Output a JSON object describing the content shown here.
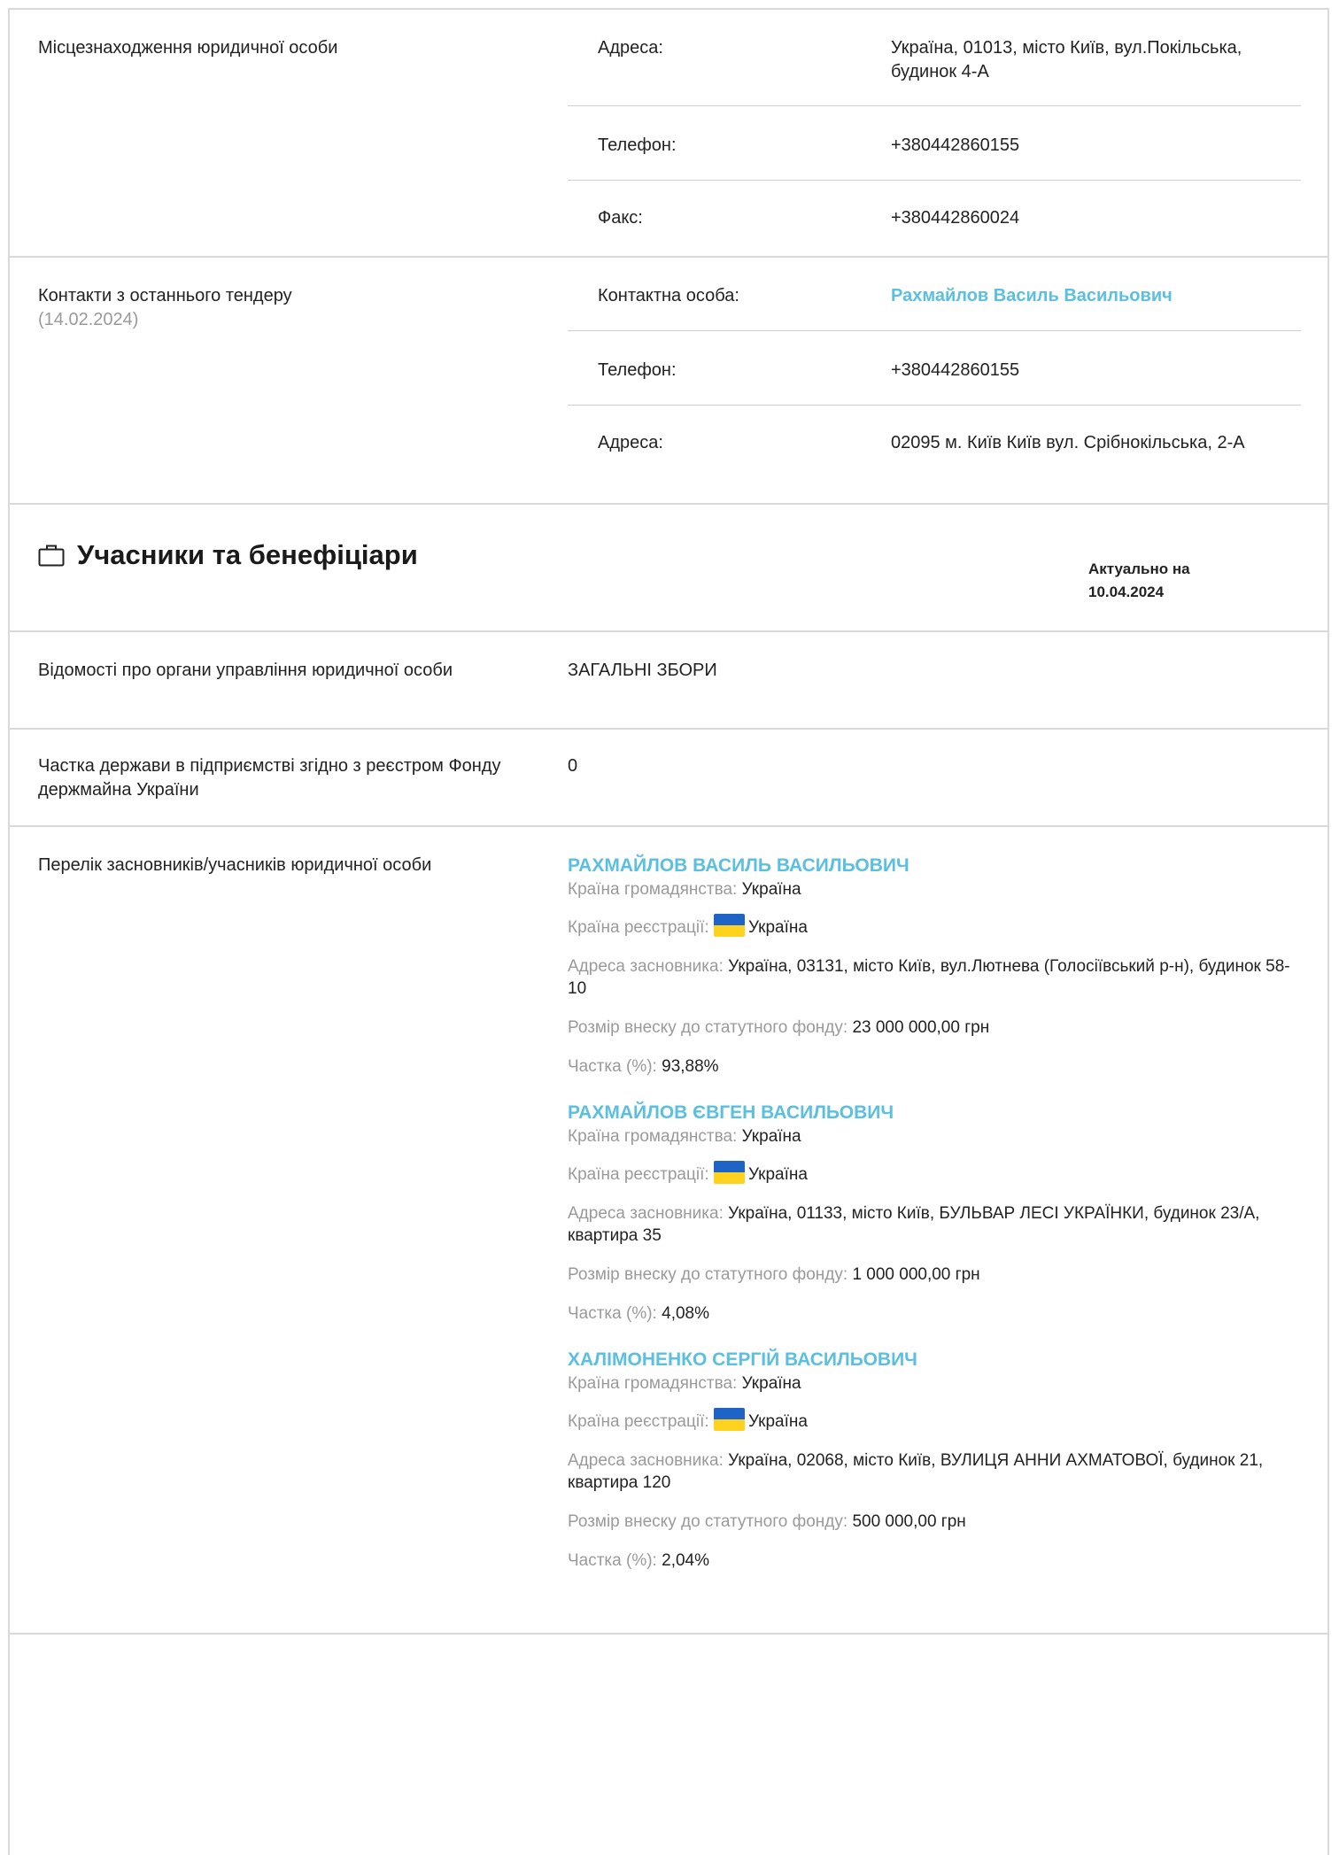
{
  "location": {
    "label": "Місцезнаходження юридичної особи",
    "address_key": "Адреса:",
    "address_val": "Україна, 01013, місто Київ, вул.Покільська, будинок 4-А",
    "phone_key": "Телефон:",
    "phone_val": "+380442860155",
    "fax_key": "Факс:",
    "fax_val": "+380442860024"
  },
  "tender": {
    "label": "Контакти з останнього тендеру",
    "date": "(14.02.2024)",
    "person_key": "Контактна особа:",
    "person_val": "Рахмайлов Василь Васильович",
    "phone_key": "Телефон:",
    "phone_val": "+380442860155",
    "address_key": "Адреса:",
    "address_val": "02095 м. Київ Київ вул. Срібнокільська, 2-А"
  },
  "participants": {
    "title": "Учасники та бенефіціари",
    "asof_label": "Актуально на",
    "asof_date": "10.04.2024",
    "icon": "briefcase-icon"
  },
  "governance": {
    "label": "Відомості про органи управління юридичної особи",
    "value": "ЗАГАЛЬНІ ЗБОРИ"
  },
  "state_share": {
    "label": "Частка держави в підприємстві згідно з реєстром Фонду держмайна України",
    "value": "0"
  },
  "founders": {
    "label": "Перелік засновників/учасників юридичної особи",
    "k_citizenship": "Країна громадянства:",
    "k_registration": "Країна реєстрації:",
    "k_address": "Адреса засновника:",
    "k_contribution": "Розмір внеску до статутного фонду:",
    "k_share": "Частка (%):",
    "items": [
      {
        "name": "РАХМАЙЛОВ ВАСИЛЬ ВАСИЛЬОВИЧ",
        "citizenship": "Україна",
        "registration": "Україна",
        "address": "Україна, 03131, місто Київ, вул.Лютнева (Голосіївський р-н), будинок 58-10",
        "contribution": "23 000 000,00 грн",
        "share": "93,88%"
      },
      {
        "name": "РАХМАЙЛОВ ЄВГЕН ВАСИЛЬОВИЧ",
        "citizenship": "Україна",
        "registration": "Україна",
        "address": "Україна, 01133, місто Київ, БУЛЬВАР ЛЕСІ УКРАЇНКИ, будинок 23/А, квартира 35",
        "contribution": "1 000 000,00 грн",
        "share": "4,08%"
      },
      {
        "name": "ХАЛІМОНЕНКО СЕРГІЙ ВАСИЛЬОВИЧ",
        "citizenship": "Україна",
        "registration": "Україна",
        "address": "Україна, 02068, місто Київ, ВУЛИЦЯ АННИ АХМАТОВОЇ, будинок 21, квартира 120",
        "contribution": "500 000,00 грн",
        "share": "2,04%"
      }
    ]
  }
}
